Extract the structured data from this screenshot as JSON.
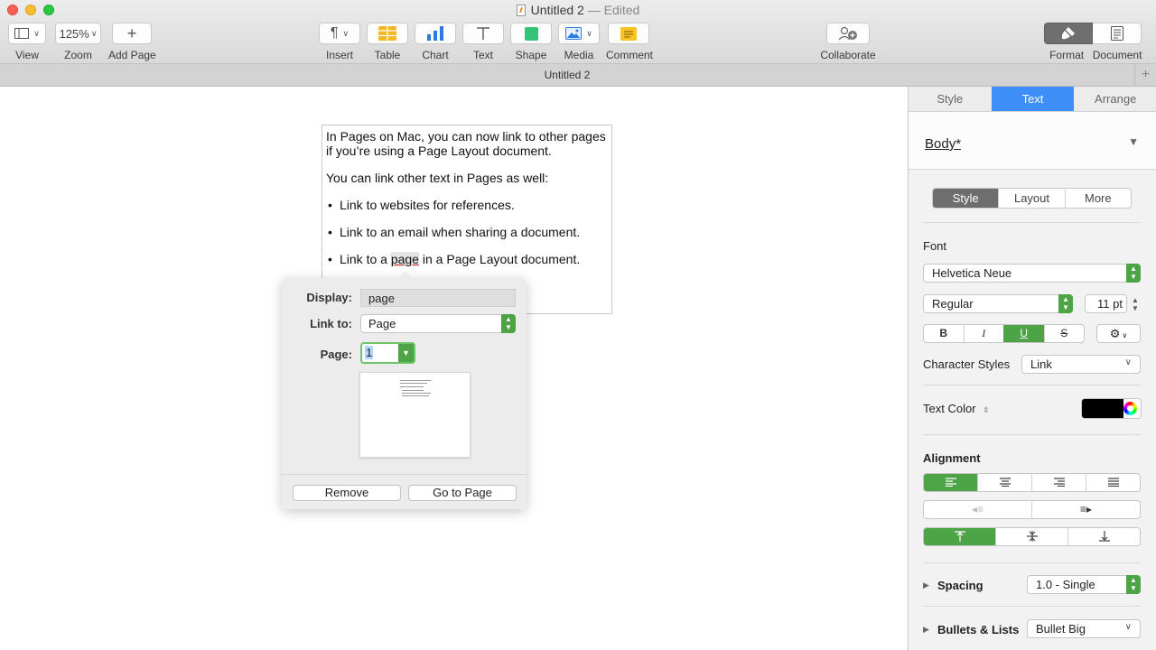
{
  "window": {
    "title": "Untitled 2",
    "edited_suffix": "— Edited"
  },
  "toolbar": {
    "view_label": "View",
    "zoom_value": "125%",
    "zoom_label": "Zoom",
    "add_page_label": "Add Page",
    "insert_label": "Insert",
    "table_label": "Table",
    "chart_label": "Chart",
    "text_label": "Text",
    "shape_label": "Shape",
    "media_label": "Media",
    "comment_label": "Comment",
    "collaborate_label": "Collaborate",
    "format_label": "Format",
    "document_label": "Document"
  },
  "tabbar": {
    "tab_title": "Untitled 2",
    "add_symbol": "+"
  },
  "document": {
    "para1": "In Pages on Mac, you can now link to other pages if you’re using a Page Layout document.",
    "para2": "You can link other text in Pages as well:",
    "bullet1": "Link to websites for references.",
    "bullet2": "Link to an email when sharing a document.",
    "bullet3_before": "Link to a ",
    "bullet3_link": "page",
    "bullet3_after": " in a Page Layout document."
  },
  "link_popover": {
    "display_label": "Display:",
    "display_value": "page",
    "link_to_label": "Link to:",
    "link_to_value": "Page",
    "page_label": "Page:",
    "page_value": "1",
    "remove_label": "Remove",
    "go_to_page_label": "Go to Page"
  },
  "inspector": {
    "tabs": [
      {
        "label": "Style",
        "active": false
      },
      {
        "label": "Text",
        "active": true
      },
      {
        "label": "Arrange",
        "active": false
      }
    ],
    "paragraph_style": "Body*",
    "sub_tabs": [
      {
        "label": "Style",
        "active": true
      },
      {
        "label": "Layout",
        "active": false
      },
      {
        "label": "More",
        "active": false
      }
    ],
    "font_section_label": "Font",
    "font_family": "Helvetica Neue",
    "font_typeface": "Regular",
    "font_size": "11 pt",
    "format_buttons": {
      "bold": "B",
      "italic": "I",
      "underline": "U",
      "strikethrough": "S"
    },
    "underline_active": true,
    "character_styles_label": "Character Styles",
    "character_style_value": "Link",
    "text_color_label": "Text Color",
    "text_color": "#000000",
    "alignment_label": "Alignment",
    "alignment_active": "left",
    "vertical_alignment_active": "top",
    "spacing_label": "Spacing",
    "spacing_value": "1.0 - Single",
    "bullets_label": "Bullets & Lists",
    "bullets_value": "Bullet Big"
  },
  "colors": {
    "accent_blue": "#3d8ef7",
    "accent_green": "#4ca446"
  }
}
